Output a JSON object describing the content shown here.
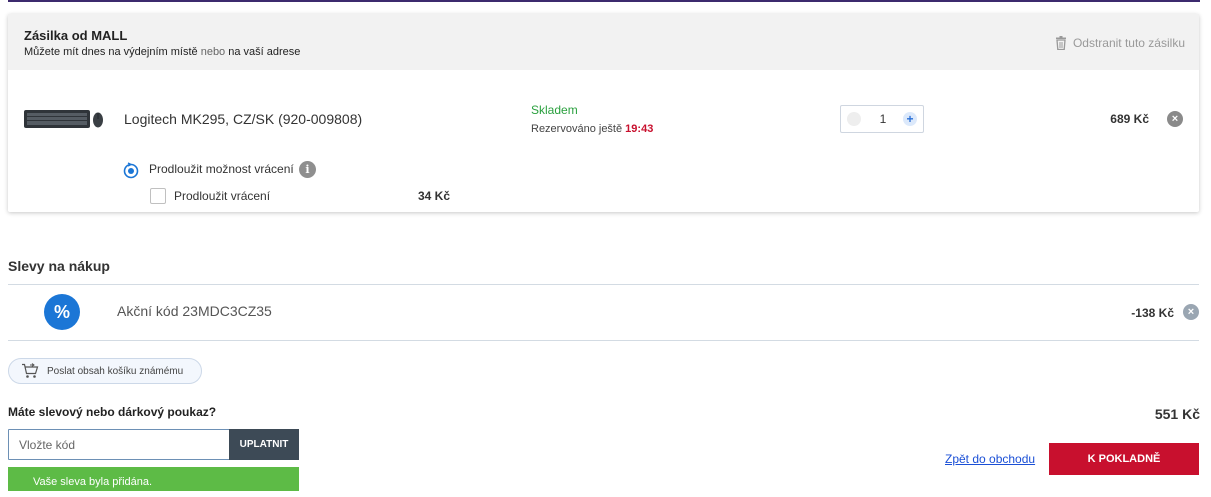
{
  "shipment": {
    "title": "Zásilka od MALL",
    "subtitle_a": "Můžete mít dnes na výdejním místě",
    "subtitle_or": "nebo",
    "subtitle_b": "na vaší adrese",
    "remove_label": "Odstranit tuto zásilku"
  },
  "product": {
    "name": "Logitech MK295, CZ/SK (920-009808)",
    "stock": "Skladem",
    "reserved_label": "Rezervováno ještě",
    "reserved_time": "19:43",
    "quantity": "1",
    "price": "689 Kč",
    "remove_icon": "×"
  },
  "extension": {
    "label": "Prodloužit možnost vrácení",
    "info_icon": "i",
    "checkbox_label": "Prodloužit vrácení",
    "price": "34 Kč"
  },
  "discounts": {
    "title": "Slevy na nákup",
    "icon": "%",
    "code_label": "Akční kód 23MDC3CZ35",
    "amount": "-138 Kč",
    "remove_icon": "×"
  },
  "share": {
    "label": "Poslat obsah košíku známému"
  },
  "voucher": {
    "question": "Máte slevový nebo dárkový poukaz?",
    "placeholder": "Vložte kód",
    "apply_label": "UPLATNIT",
    "success_message": "Vaše sleva byla přidána."
  },
  "summary": {
    "total": "551 Kč",
    "back_link": "Zpět do obchodu",
    "checkout_label": "K POKLADNĚ"
  },
  "colors": {
    "accent_red": "#c8102e",
    "success_green": "#5dbb46",
    "stock_green": "#2aa03e",
    "link_blue": "#1a4fd6",
    "discount_blue": "#1b76d6"
  }
}
